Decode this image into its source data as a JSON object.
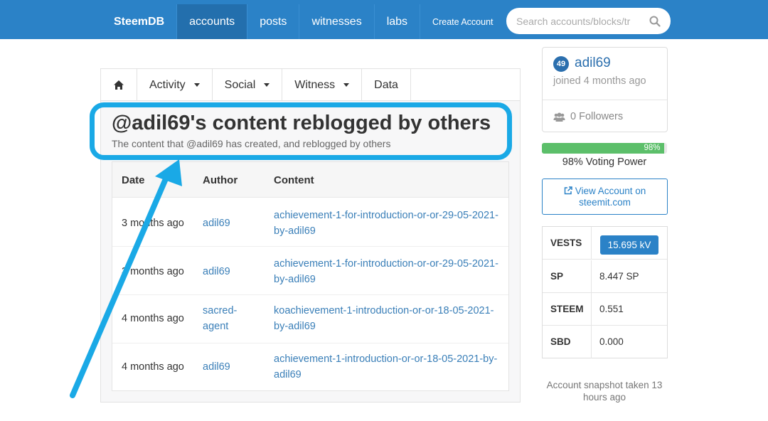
{
  "nav": {
    "brand": "SteemDB",
    "items": [
      "accounts",
      "posts",
      "witnesses",
      "labs",
      "Create Account"
    ],
    "search_placeholder": "Search accounts/blocks/tr"
  },
  "subnav": {
    "items": [
      "Activity",
      "Social",
      "Witness",
      "Data"
    ]
  },
  "page": {
    "title": "@adil69's content reblogged by others",
    "subtitle": "The content that @adil69 has created, and reblogged by others"
  },
  "table": {
    "headers": [
      "Date",
      "Author",
      "Content"
    ],
    "rows": [
      {
        "date": "3 months ago",
        "author": "adil69",
        "content": "achievement-1-for-introduction-or-or-29-05-2021-by-adil69"
      },
      {
        "date": "3 months ago",
        "author": "adil69",
        "content": "achievement-1-for-introduction-or-or-29-05-2021-by-adil69"
      },
      {
        "date": "4 months ago",
        "author": "sacred-agent",
        "content": "koachievement-1-introduction-or-or-18-05-2021-by-adil69"
      },
      {
        "date": "4 months ago",
        "author": "adil69",
        "content": "achievement-1-introduction-or-or-18-05-2021-by-adil69"
      }
    ]
  },
  "profile": {
    "reputation": "49",
    "username": "adil69",
    "joined": "joined 4 months ago",
    "followers": "0 Followers"
  },
  "voting": {
    "percent": 98,
    "bar_label": "98%",
    "label": "98% Voting Power"
  },
  "view_account": {
    "line1": "View Account on",
    "line2": "steemit.com"
  },
  "wallet": {
    "rows": [
      {
        "key": "VESTS",
        "value": "15.695 kV"
      },
      {
        "key": "SP",
        "value": "8.447 SP"
      },
      {
        "key": "STEEM",
        "value": "0.551"
      },
      {
        "key": "SBD",
        "value": "0.000"
      }
    ]
  },
  "snapshot": "Account snapshot taken 13 hours ago",
  "colors": {
    "brand_blue": "#2b82c7",
    "highlight": "#1aa9e6",
    "voting_green": "#5cbf6a"
  }
}
